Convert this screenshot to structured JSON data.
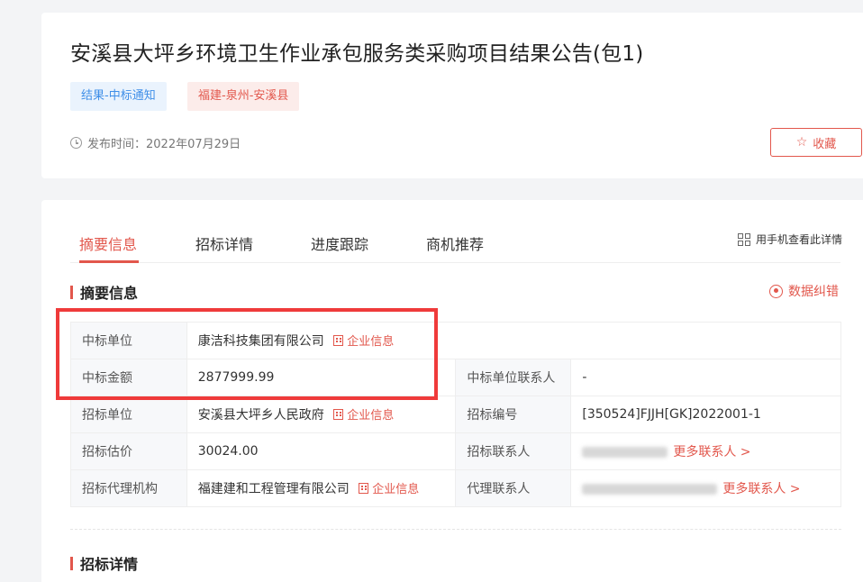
{
  "header": {
    "title": "安溪县大坪乡环境卫生作业承包服务类采购项目结果公告(包1)",
    "tags": [
      "结果-中标通知",
      "福建-泉州-安溪县"
    ],
    "publish_label": "发布时间：2022年07月29日",
    "favorite_label": "收藏",
    "colors": {
      "accent": "#e2574c",
      "tag_blue": "#3f8fe8",
      "highlight": "#ef3a3a"
    }
  },
  "tabs": [
    {
      "label": "摘要信息",
      "active": true
    },
    {
      "label": "招标详情",
      "active": false
    },
    {
      "label": "进度跟踪",
      "active": false
    },
    {
      "label": "商机推荐",
      "active": false
    }
  ],
  "mobile_view_label": "用手机查看此详情",
  "summary": {
    "title": "摘要信息",
    "correct_label": "数据纠错",
    "corp_info_label": "企业信息",
    "more_contacts_label": "更多联系人 >",
    "rows": [
      {
        "label1": "中标单位",
        "value1": "康洁科技集团有限公司",
        "link1": true,
        "label2": "",
        "value2": ""
      },
      {
        "label1": "中标金额",
        "value1": "2877999.99",
        "link1": false,
        "label2": "中标单位联系人",
        "value2": "-"
      },
      {
        "label1": "招标单位",
        "value1": "安溪县大坪乡人民政府",
        "link1": true,
        "label2": "招标编号",
        "value2": "[350524]FJJH[GK]2022001-1"
      },
      {
        "label1": "招标估价",
        "value1": "30024.00",
        "link1": false,
        "label2": "招标联系人",
        "value2": ""
      },
      {
        "label1": "招标代理机构",
        "value1": "福建建和工程管理有限公司",
        "link1": true,
        "label2": "代理联系人",
        "value2": ""
      }
    ]
  },
  "details_title": "招标详情"
}
